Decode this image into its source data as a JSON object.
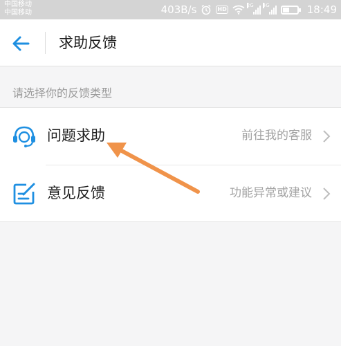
{
  "status_bar": {
    "carrier_1": "中国移动",
    "carrier_2": "中国移动",
    "net_speed": "403B/s",
    "hd_badge": "HD",
    "sig1_tag": "2G",
    "sig2_tag": "4G",
    "time": "18:49"
  },
  "header": {
    "title": "求助反馈"
  },
  "section": {
    "label": "请选择你的反馈类型"
  },
  "items": [
    {
      "label": "问题求助",
      "subtitle": "前往我的客服",
      "icon": "headset-icon"
    },
    {
      "label": "意见反馈",
      "subtitle": "功能异常或建议",
      "icon": "edit-note-icon"
    }
  ],
  "colors": {
    "accent": "#1e8fe1",
    "annotation_arrow": "#f0934a"
  }
}
